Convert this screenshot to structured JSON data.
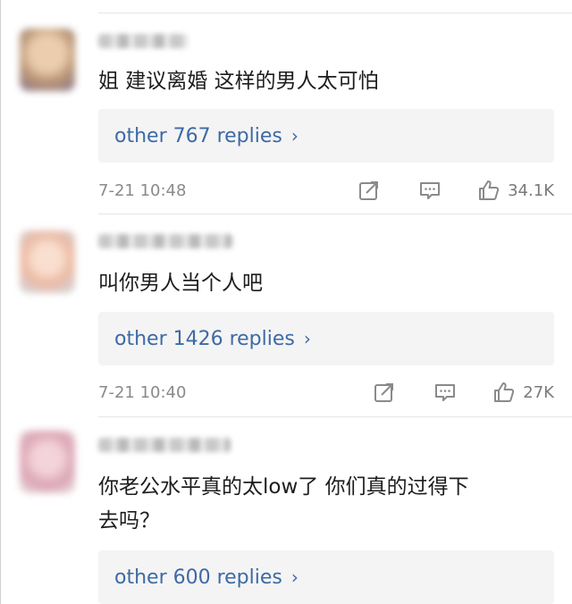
{
  "comments": [
    {
      "text": "姐 建议离婚 这样的男人太可怕",
      "replies_label": "other 767 replies",
      "time": "7-21 10:48",
      "likes": "34.1K",
      "avatar_color": "#c4a07d"
    },
    {
      "text": "叫你男人当个人吧",
      "replies_label": "other 1426 replies",
      "time": "7-21 10:40",
      "likes": "27K",
      "avatar_color": "#f0c0a0"
    },
    {
      "text_line1": "你老公水平真的太low了 你们真的过得下",
      "text_line2": "去吗？",
      "replies_label": "other 600 replies",
      "avatar_color": "#d9a8b4"
    }
  ],
  "icons": {
    "share": "share-icon",
    "comment": "comment-icon",
    "like": "thumbs-up-icon",
    "chevron": "chevron-right-icon"
  },
  "colors": {
    "link": "#3d6aa5",
    "reply_bg": "#f4f4f4",
    "meta_text": "#8a8a8a"
  }
}
